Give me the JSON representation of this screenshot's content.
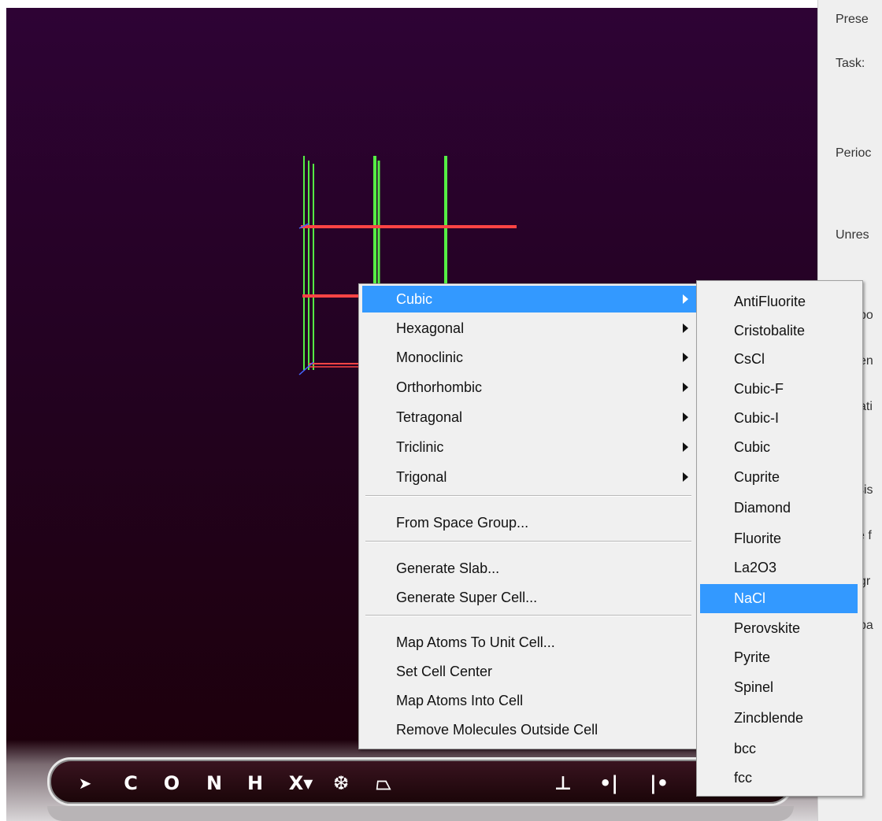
{
  "right_panel": {
    "labels": [
      "Prese",
      "Task:",
      "Perioc",
      "Unres",
      "po",
      "en",
      "ati",
      "sis",
      "e f",
      "gr",
      "pa"
    ]
  },
  "toolbar": {
    "tools": [
      {
        "name": "select-arrow-icon",
        "glyph": "➤"
      },
      {
        "name": "carbon-tool",
        "glyph": "C"
      },
      {
        "name": "oxygen-tool",
        "glyph": "O"
      },
      {
        "name": "nitrogen-tool",
        "glyph": "N"
      },
      {
        "name": "hydrogen-tool",
        "glyph": "H"
      },
      {
        "name": "element-x-dropdown",
        "glyph": "X▾"
      },
      {
        "name": "fragment-snowflake-icon",
        "glyph": "❆"
      },
      {
        "name": "cell-plane-icon",
        "glyph": "⏢"
      },
      {
        "name": "add-atom-icon",
        "glyph": "⊥"
      },
      {
        "name": "bond-right-icon",
        "glyph": "•|"
      },
      {
        "name": "bond-left-icon",
        "glyph": "|•"
      }
    ]
  },
  "build_menu": {
    "items": [
      {
        "label": "Cubic",
        "submenu": true,
        "selected": true
      },
      {
        "label": "Hexagonal",
        "submenu": true
      },
      {
        "label": "Monoclinic",
        "submenu": true
      },
      {
        "label": "Orthorhombic",
        "submenu": true
      },
      {
        "label": "Tetragonal",
        "submenu": true
      },
      {
        "label": "Triclinic",
        "submenu": true
      },
      {
        "label": "Trigonal",
        "submenu": true
      },
      {
        "label": "From Space Group..."
      },
      {
        "label": "Generate Slab..."
      },
      {
        "label": "Generate Super Cell..."
      },
      {
        "label": "Map Atoms To Unit Cell..."
      },
      {
        "label": "Set Cell Center"
      },
      {
        "label": "Map Atoms Into Cell"
      },
      {
        "label": "Remove Molecules Outside Cell"
      }
    ]
  },
  "cubic_submenu": {
    "items": [
      {
        "label": "AntiFluorite"
      },
      {
        "label": "Cristobalite"
      },
      {
        "label": "CsCl"
      },
      {
        "label": "Cubic-F"
      },
      {
        "label": "Cubic-I"
      },
      {
        "label": "Cubic"
      },
      {
        "label": "Cuprite"
      },
      {
        "label": "Diamond"
      },
      {
        "label": "Fluorite"
      },
      {
        "label": "La2O3"
      },
      {
        "label": "NaCl",
        "selected": true
      },
      {
        "label": "Perovskite"
      },
      {
        "label": "Pyrite"
      },
      {
        "label": "Spinel"
      },
      {
        "label": "Zincblende"
      },
      {
        "label": "bcc"
      },
      {
        "label": "fcc"
      }
    ]
  },
  "colors": {
    "selection": "#3399ff",
    "axis_green": "#55ee44",
    "axis_red": "#ff4444",
    "axis_blue": "#4466ff"
  }
}
